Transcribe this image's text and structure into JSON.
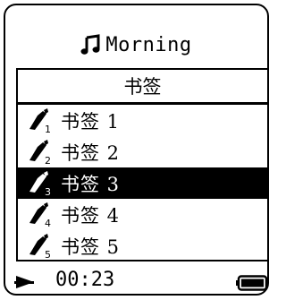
{
  "title": {
    "text": "Morning",
    "icon": "music-note-icon"
  },
  "list": {
    "header": "书签",
    "items": [
      {
        "label": "书签 1",
        "icon": "bookmark-icon",
        "index": "1",
        "selected": false
      },
      {
        "label": "书签 2",
        "icon": "bookmark-icon",
        "index": "2",
        "selected": false
      },
      {
        "label": "书签 3",
        "icon": "bookmark-icon",
        "index": "3",
        "selected": true
      },
      {
        "label": "书签 4",
        "icon": "bookmark-icon",
        "index": "4",
        "selected": false
      },
      {
        "label": "书签 5",
        "icon": "bookmark-icon",
        "index": "5",
        "selected": false
      }
    ]
  },
  "status": {
    "play_icon": "play-icon",
    "time": "00:23",
    "battery_icon": "battery-full-icon",
    "battery_level": 1.0
  },
  "colors": {
    "foreground": "#000000",
    "background": "#ffffff",
    "highlight": "#000000"
  }
}
